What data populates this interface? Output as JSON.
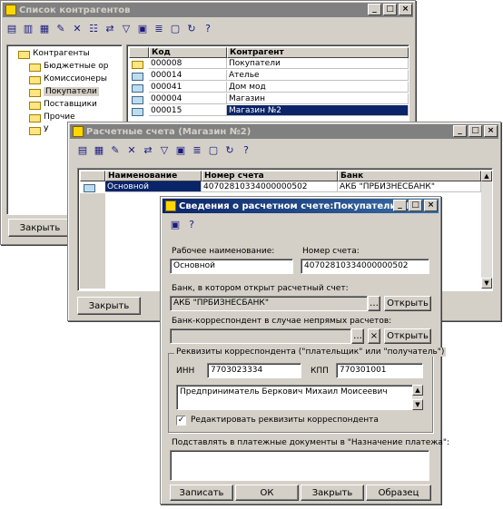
{
  "win1": {
    "title": "Список контрагентов",
    "tree": [
      "Контрагенты",
      "Бюджетные ор",
      "Комиссионеры",
      "Покупатели",
      "Поставщики",
      "Прочие",
      "У"
    ],
    "grid_headers": [
      "Код",
      "Контрагент"
    ],
    "rows": [
      {
        "code": "000008",
        "name": "Покупатели"
      },
      {
        "code": "000014",
        "name": "Ателье"
      },
      {
        "code": "000041",
        "name": "Дом мод"
      },
      {
        "code": "000004",
        "name": "Магазин"
      },
      {
        "code": "000015",
        "name": "Магазин №2"
      }
    ],
    "close_label": "Закрыть"
  },
  "win2": {
    "title": "Расчетные счета (Магазин №2)",
    "grid_headers": [
      "Наименование",
      "Номер счета",
      "Банк"
    ],
    "rows": [
      {
        "name": "Основной",
        "account": "40702810334000000502",
        "bank": "АКБ \"ПРБИЗНЕСБАНК\""
      }
    ],
    "close_label": "Закрыть"
  },
  "dlg": {
    "title": "Сведения о расчетном счете:Покупатели.Маг...",
    "work_name_label": "Рабочее наименование:",
    "work_name_value": "Основной",
    "account_label": "Номер счета:",
    "account_value": "40702810334000000502",
    "bank_label": "Банк, в котором открыт расчетный счет:",
    "bank_value": "АКБ \"ПРБИЗНЕСБАНК\"",
    "open1_label": "Открыть",
    "corr_label": "Банк-корреспондент в случае непрямых расчетов:",
    "corr_value": "",
    "open2_label": "Открыть",
    "req_group_label": "Реквизиты корреспондента (\"плательщик\" или \"получатель\")",
    "inn_label": "ИНН",
    "inn_value": "7703023334",
    "kpp_label": "КПП",
    "kpp_value": "770301001",
    "corr_name_value": "Предприниматель Беркович Михаил Моисеевич",
    "edit_checkbox_label": "Редактировать реквизиты корреспондента",
    "purpose_label": "Подставлять в платежные документы в \"Назначение платежа\":",
    "purpose_value": "",
    "buttons": [
      "Записать",
      "ОК",
      "Закрыть",
      "Образец"
    ]
  },
  "colors": {
    "active_title": "#0a246a",
    "inactive_title": "#808080",
    "selection": "#0a246a"
  }
}
